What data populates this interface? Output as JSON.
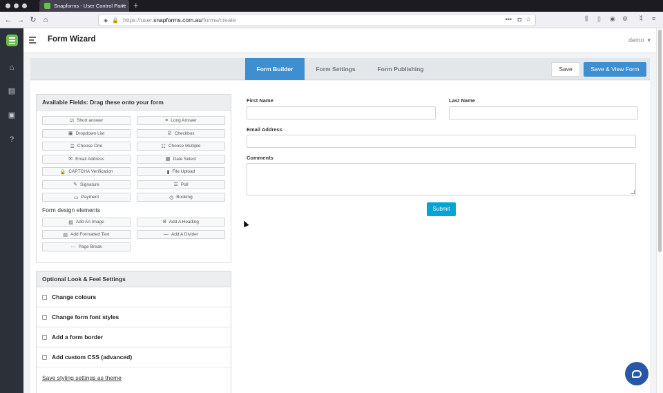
{
  "browser": {
    "tab_title": "Snapforms - User Control Pane",
    "tab_close": "×",
    "new_tab": "+",
    "url_prefix": "https://user.",
    "url_domain": "snapforms.com.au",
    "url_path": "/forms/create"
  },
  "sidebar": {
    "items": [
      {
        "icon": "home-icon",
        "glyph": "⌂"
      },
      {
        "icon": "inbox-icon",
        "glyph": "▤"
      },
      {
        "icon": "document-icon",
        "glyph": "▣"
      },
      {
        "icon": "help-icon",
        "glyph": "?"
      }
    ]
  },
  "header": {
    "title": "Form Wizard",
    "user": "demo",
    "user_caret": "▾"
  },
  "tabs": {
    "builder": "Form Builder",
    "settings": "Form Settings",
    "publishing": "Form Publishing"
  },
  "actions": {
    "save": "Save",
    "save_view": "Save & View Form"
  },
  "fields_panel": {
    "title": "Available Fields: Drag these onto your form",
    "fields": [
      {
        "label": "Short answer",
        "icon": "edit-icon",
        "glyph": "☑"
      },
      {
        "label": "Long Answer",
        "icon": "align-left-icon",
        "glyph": "≡"
      },
      {
        "label": "Dropdown List",
        "icon": "dropdown-icon",
        "glyph": "▣"
      },
      {
        "label": "Checkbox",
        "icon": "checkbox-icon",
        "glyph": "☑"
      },
      {
        "label": "Choose One",
        "icon": "list-icon",
        "glyph": "☰"
      },
      {
        "label": "Choose Multiple",
        "icon": "list-check-icon",
        "glyph": "☷"
      },
      {
        "label": "Email Address",
        "icon": "envelope-icon",
        "glyph": "✉"
      },
      {
        "label": "Date Select",
        "icon": "calendar-icon",
        "glyph": "▦"
      },
      {
        "label": "CAPTCHA Verification",
        "icon": "lock-icon",
        "glyph": "🔒"
      },
      {
        "label": "File Upload",
        "icon": "file-icon",
        "glyph": "▮"
      },
      {
        "label": "Signature",
        "icon": "pen-icon",
        "glyph": "✎"
      },
      {
        "label": "Poll",
        "icon": "poll-icon",
        "glyph": "☰"
      },
      {
        "label": "Payment",
        "icon": "credit-card-icon",
        "glyph": "▭"
      },
      {
        "label": "Booking",
        "icon": "clock-icon",
        "glyph": "◷"
      }
    ],
    "design_title": "Form design elements",
    "design": [
      {
        "label": "Add An Image",
        "icon": "image-icon",
        "glyph": "▨"
      },
      {
        "label": "Add A Heading",
        "icon": "bold-icon",
        "glyph": "B"
      },
      {
        "label": "Add Formatted Text",
        "icon": "text-icon",
        "glyph": "▤"
      },
      {
        "label": "Add A Divider",
        "icon": "minus-icon",
        "glyph": "—"
      },
      {
        "label": "Page Break",
        "icon": "page-break-icon",
        "glyph": "⋯"
      }
    ]
  },
  "style_panel": {
    "title": "Optional Look & Feel Settings",
    "options": [
      {
        "label": "Change colours",
        "checked": false
      },
      {
        "label": "Change form font styles",
        "checked": false
      },
      {
        "label": "Add a form border",
        "checked": false
      },
      {
        "label": "Add custom CSS (advanced)",
        "checked": false
      }
    ],
    "save_theme": "Save styling settings as theme"
  },
  "form": {
    "first_name": "First Name",
    "last_name": "Last Name",
    "email": "Email Address",
    "comments": "Comments",
    "submit": "Submit"
  },
  "colors": {
    "accent": "#3d8fd1",
    "submit": "#00a4d6",
    "sidebar": "#2c3038",
    "brand": "#6bbf4a",
    "chat": "#2757a6"
  }
}
